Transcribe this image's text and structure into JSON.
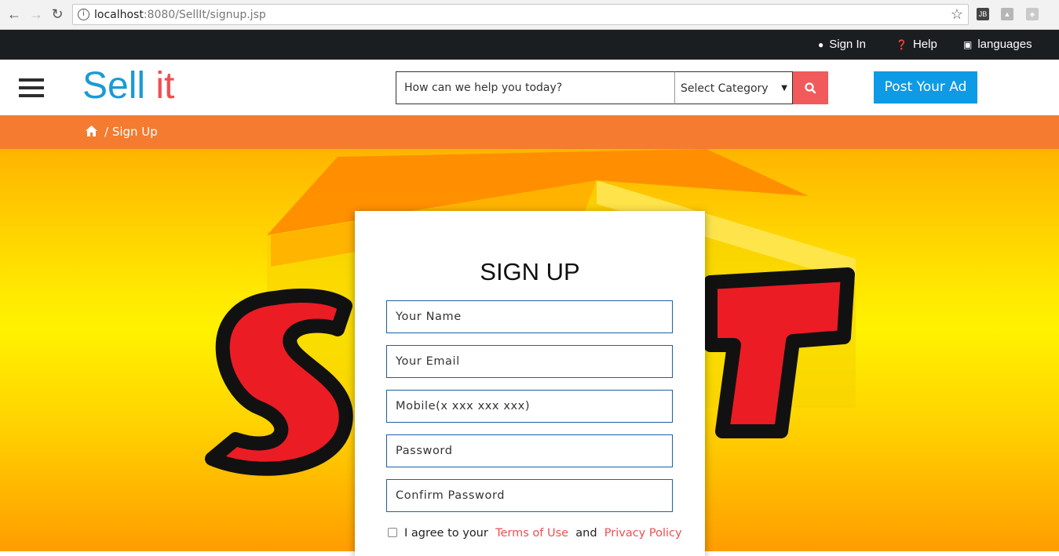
{
  "browser": {
    "url_host": "localhost",
    "url_rest": ":8080/SellIt/signup.jsp"
  },
  "topbar": {
    "sign_in": "Sign In",
    "help": "Help",
    "languages": "languages"
  },
  "header": {
    "logo_part1": "Sell",
    "logo_part2": "it",
    "search_placeholder": "How can we help you today?",
    "category_selected": "Select Category",
    "post_ad": "Post Your Ad"
  },
  "breadcrumb": {
    "current": "/ Sign Up"
  },
  "form": {
    "title": "SIGN UP",
    "fields": [
      "Your Name",
      "Your Email",
      "Mobile(x xxx xxx xxx)",
      "Password",
      "Confirm Password"
    ],
    "agree_text": "I agree to your",
    "terms": "Terms of Use",
    "and": "and",
    "privacy": "Privacy Policy"
  },
  "hero": {
    "watermark_text": "SELL IT"
  },
  "colors": {
    "brand_blue": "#1a9ad6",
    "brand_red": "#f04e4e",
    "breadcrumb_orange": "#f47b30",
    "button_blue": "#0e9ae5",
    "topbar_dark": "#1b1e21"
  }
}
